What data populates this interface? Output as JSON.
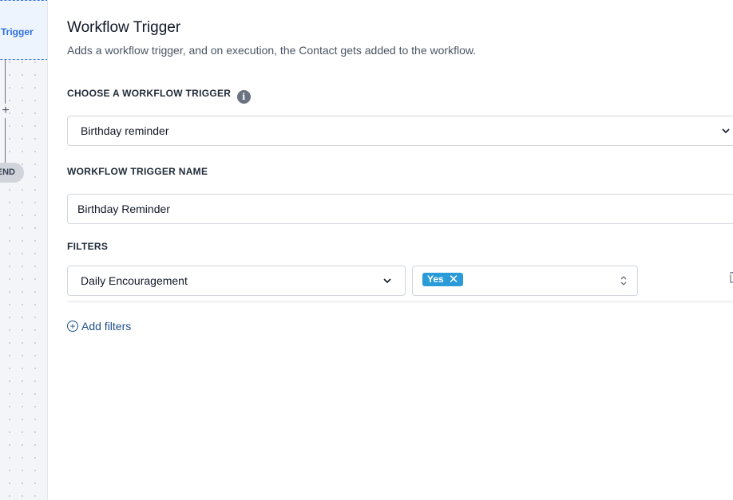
{
  "canvas": {
    "trigger_node_label": "Trigger",
    "add_step_symbol": "+",
    "end_label": "END"
  },
  "panel": {
    "title": "Workflow Trigger",
    "subtitle": "Adds a workflow trigger, and on execution, the Contact gets added to the workflow.",
    "choose_trigger_label": "CHOOSE A WORKFLOW TRIGGER",
    "choose_trigger_value": "Birthday reminder",
    "trigger_name_label": "WORKFLOW TRIGGER NAME",
    "trigger_name_value": "Birthday Reminder",
    "filters_label": "FILTERS",
    "filter_field_value": "Daily Encouragement",
    "filter_tag": "Yes",
    "add_filters_label": "Add filters"
  },
  "icons": {
    "info": "info-icon",
    "chevron": "chevron-down-icon",
    "updown": "sort-updown-icon",
    "remove": "close-icon",
    "add": "plus-circle-icon",
    "trash": "trash-icon"
  },
  "colors": {
    "accent_blue": "#2f6fdc",
    "tag_blue": "#2b9bd8",
    "link_blue": "#1f4f8a"
  }
}
